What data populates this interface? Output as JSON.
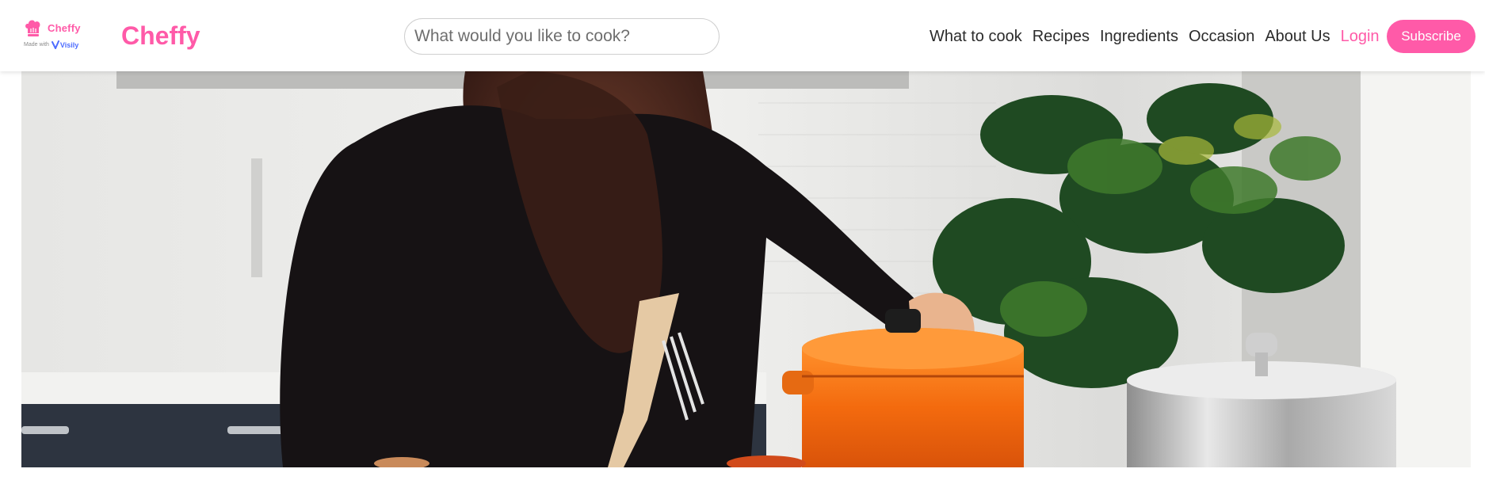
{
  "badge": {
    "icon": "chef-hat-icon",
    "name": "Cheffy",
    "made_with": "Made with",
    "visily": "Visily"
  },
  "brand": {
    "name": "Cheffy"
  },
  "search": {
    "placeholder": "What would you like to cook?"
  },
  "nav": {
    "items": [
      "What to cook",
      "Recipes",
      "Ingredients",
      "Occasion",
      "About Us"
    ],
    "login": "Login",
    "subscribe": "Subscribe"
  },
  "hero": {
    "image": "woman-cooking-photo"
  },
  "colors": {
    "brand_pink": "#ff5aa8",
    "nav_text": "#2b2b2b",
    "header_bg": "#ffffff"
  }
}
